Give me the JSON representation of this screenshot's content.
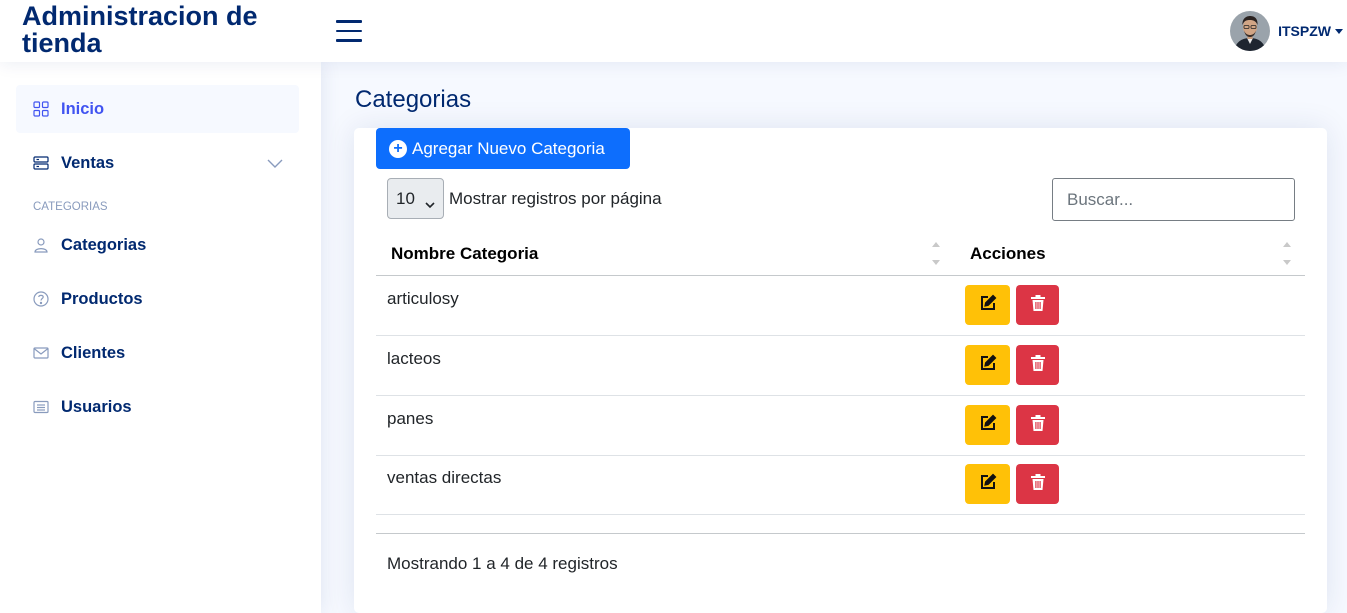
{
  "header": {
    "logo_text": "Administracion de tienda",
    "user_name": "ITSPZW"
  },
  "sidebar": {
    "items": [
      {
        "label": "Inicio",
        "icon": "grid-icon",
        "active": true
      },
      {
        "label": "Ventas",
        "icon": "server-icon",
        "expandable": true
      }
    ],
    "heading": "CATEGORIAS",
    "sub_items": [
      {
        "label": "Categorias",
        "icon": "person-icon"
      },
      {
        "label": "Productos",
        "icon": "question-circle-icon"
      },
      {
        "label": "Clientes",
        "icon": "envelope-icon"
      },
      {
        "label": "Usuarios",
        "icon": "card-list-icon"
      }
    ]
  },
  "main": {
    "title": "Categorias",
    "add_button": "Agregar Nuevo Categoria",
    "page_size": "10",
    "page_size_label": "Mostrar registros por página",
    "search_placeholder": "Buscar...",
    "table": {
      "columns": [
        "Nombre Categoria",
        "Acciones"
      ],
      "rows": [
        "articulosy",
        "lacteos",
        "panes",
        "ventas directas"
      ]
    },
    "info": "Mostrando 1 a 4 de 4 registros"
  },
  "colors": {
    "brand": "#012970",
    "accent": "#4154f1",
    "primary_button": "#0d6efd",
    "edit_button": "#ffc107",
    "delete_button": "#dc3545"
  }
}
